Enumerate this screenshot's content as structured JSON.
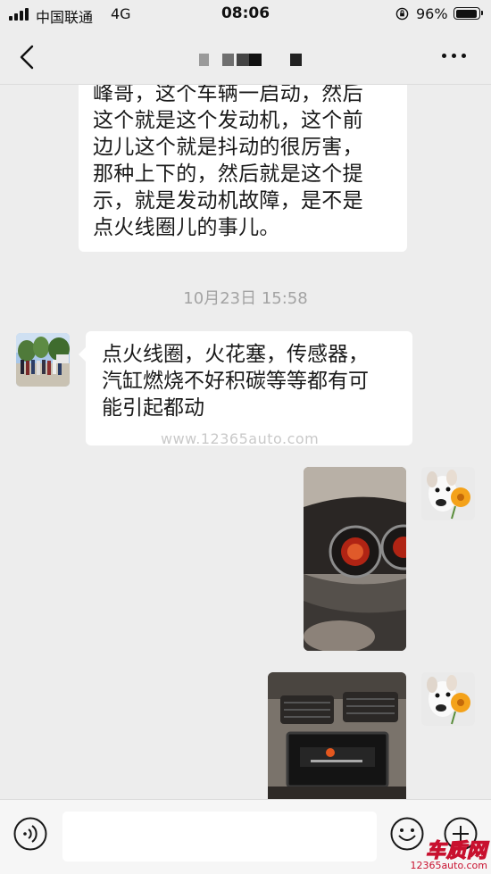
{
  "status_bar": {
    "carrier": "中国联通",
    "network": "4G",
    "time": "08:06",
    "battery": "96%",
    "battery_level": 0.96,
    "signal_icon": "signal-bars-icon",
    "lock_icon": "orientation-lock-icon"
  },
  "nav": {
    "back_icon": "chevron-left-icon",
    "more_icon": "more-dots-icon"
  },
  "messages": [
    {
      "side": "left",
      "lines": [
        "峰哥，这个车辆一启动，然后",
        "这个就是这个发动机，这个前",
        "边儿这个就是抖动的很厉害，",
        "那种上下的，然后就是这个提",
        "示，就是发动机故障，是不是",
        "点火线圈儿的事儿。"
      ]
    },
    {
      "type": "timestamp",
      "text": "10月23日 15:58"
    },
    {
      "side": "left",
      "lines": [
        "点火线圈，火花塞，传感器，",
        "汽缸燃烧不好积碳等等都有可",
        "能引起都动"
      ]
    },
    {
      "side": "right",
      "type": "image",
      "content": "car dashboard gauge photo"
    },
    {
      "side": "right",
      "type": "image",
      "content": "car center console screen photo"
    }
  ],
  "watermark": "www.12365auto.com",
  "input_bar": {
    "voice_icon": "voice-icon",
    "emoji_icon": "emoji-icon",
    "plus_icon": "plus-icon",
    "value": ""
  },
  "logo": {
    "name": "车质网",
    "url": "12365auto.com"
  },
  "colors": {
    "background": "#ededed",
    "bubble": "#ffffff",
    "text": "#191919",
    "timestamp": "#a3a3a3",
    "logo_red": "#c8102e"
  }
}
